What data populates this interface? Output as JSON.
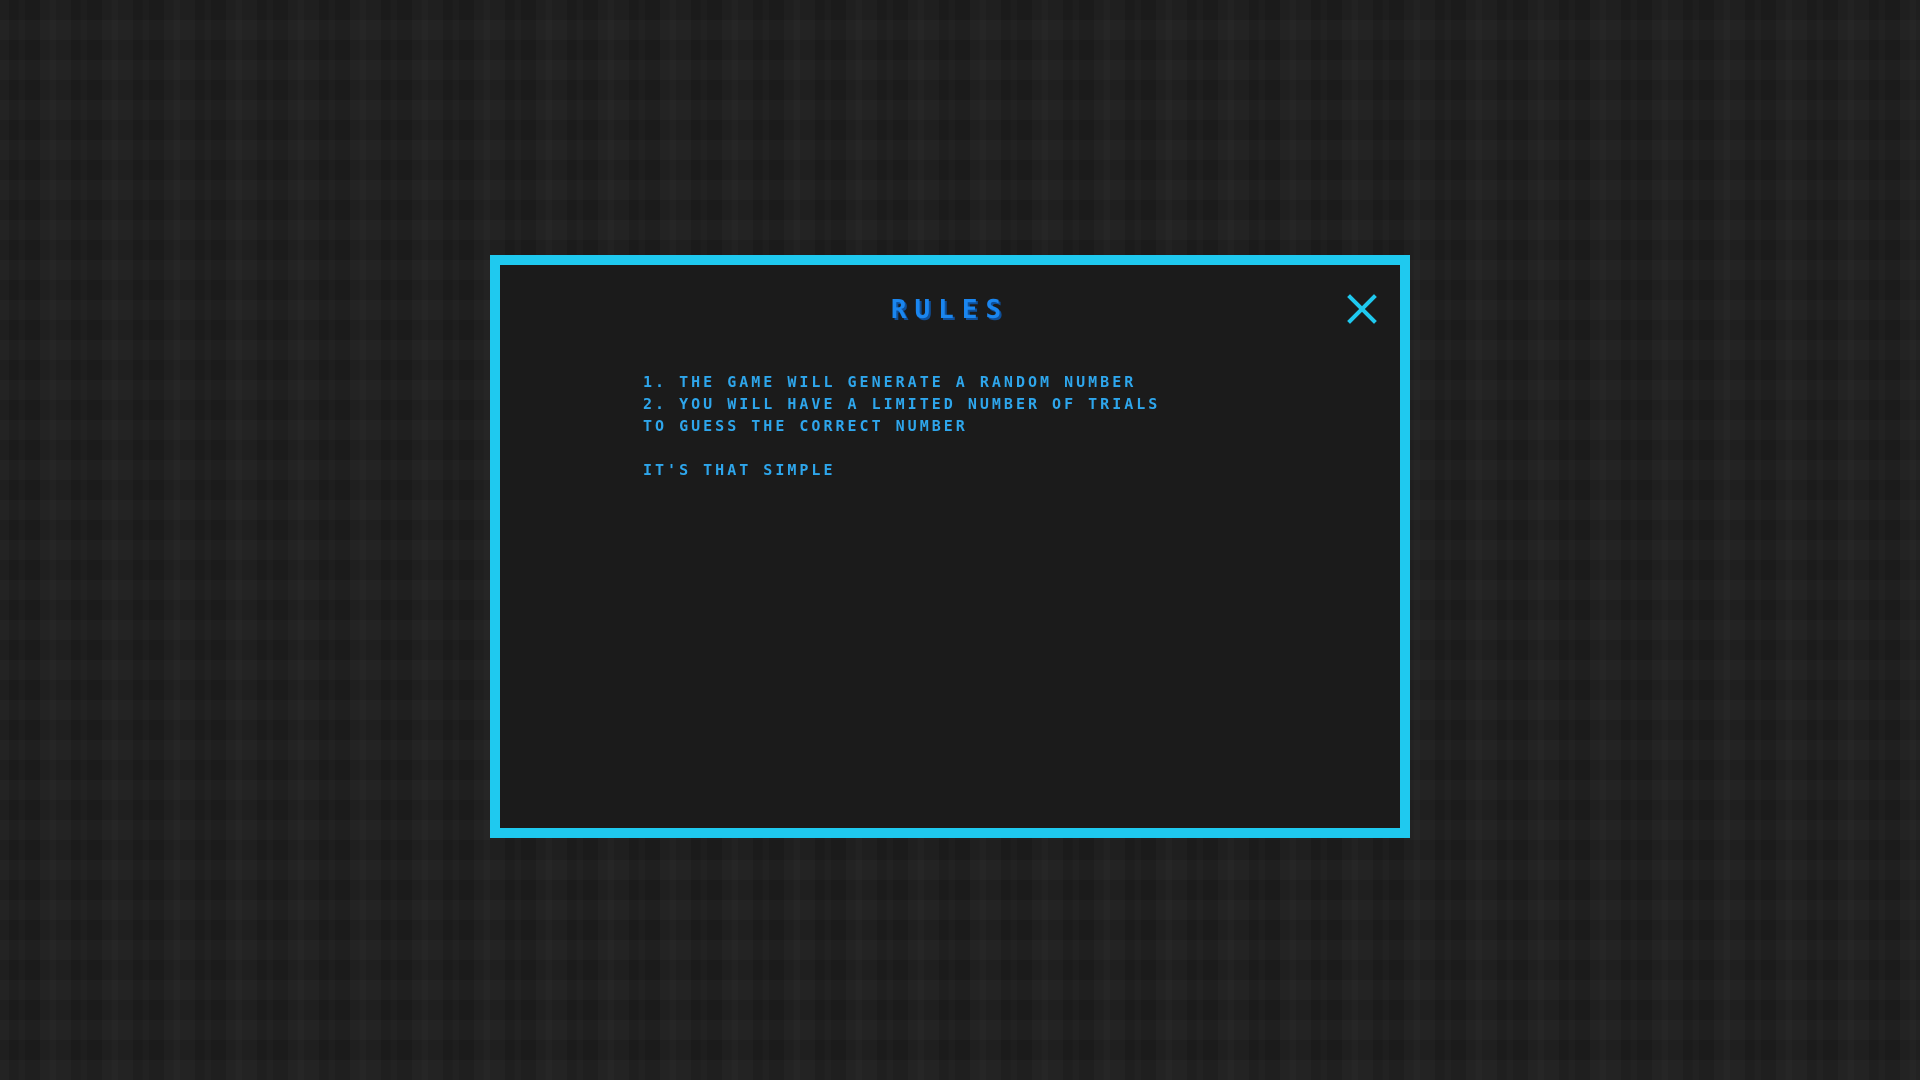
{
  "modal": {
    "title": "RULES",
    "close_icon": "close-icon",
    "rules": [
      "1. THE GAME WILL GENERATE A RANDOM NUMBER",
      "2. YOU WILL HAVE A LIMITED NUMBER OF TRIALS",
      "TO GUESS THE CORRECT NUMBER"
    ],
    "closing_line": "IT'S THAT SIMPLE"
  },
  "colors": {
    "background": "#1b1b1b",
    "border": "#1fc9ef",
    "title": "#1a86f0",
    "text": "#2ea6ec"
  }
}
